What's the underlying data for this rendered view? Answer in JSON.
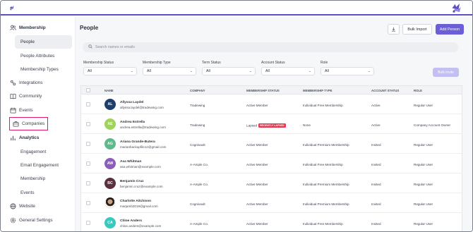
{
  "sidebar": {
    "membership_label": "Membership",
    "items": [
      {
        "label": "People"
      },
      {
        "label": "People Attributes"
      },
      {
        "label": "Membership Types"
      }
    ],
    "integrations_label": "Integrations",
    "community_label": "Community",
    "events_label": "Events",
    "companies_label": "Companies",
    "analytics_label": "Analytics",
    "analytics_items": [
      {
        "label": "Engagement"
      },
      {
        "label": "Email Engagement"
      },
      {
        "label": "Membership"
      },
      {
        "label": "Events"
      }
    ],
    "website_label": "Website",
    "settings_label": "General Settings"
  },
  "header": {
    "title": "People",
    "bulk_import_label": "Bulk Import",
    "add_person_label": "Add Person"
  },
  "search": {
    "placeholder": "Search names or emails"
  },
  "filters": [
    {
      "label": "Membership Status",
      "value": "All"
    },
    {
      "label": "Membership Type",
      "value": "All"
    },
    {
      "label": "Term Status",
      "value": "All"
    },
    {
      "label": "Account Status",
      "value": "All"
    },
    {
      "label": "Role",
      "value": "All"
    }
  ],
  "bulk_invite_label": "Bulk invite",
  "table": {
    "columns": [
      "NAME",
      "COMPANY",
      "MEMBERSHIP STATUS",
      "MEMBERSHIP TYPE",
      "ACCOUNT STATUS",
      "ROLE"
    ],
    "rows": [
      {
        "initials": "AL",
        "avatar_color": "#1f3f6b",
        "name": "Allyssa Laydel",
        "email": "allyssa.laydel@tradewing.com",
        "company": "Tradewing",
        "membership_status": "Active Member",
        "badge": "",
        "membership_type": "Individual Free Membership",
        "account_status": "Active",
        "role": "Regular User"
      },
      {
        "initials": "AE",
        "avatar_color": "#9fd35a",
        "name": "Andrea Estrella",
        "email": "andrea.estrella@tradewing.com",
        "company": "Tradewing",
        "membership_status": "Lapsed",
        "badge": "RECENTLY LAPSED",
        "membership_type": "None",
        "account_status": "Active",
        "role": "Company Account Owner"
      },
      {
        "initials": "AG",
        "avatar_color": "#5fb98c",
        "name": "Ariana Grande-Butera",
        "email": "marianbackupfile12@gmail.com",
        "company": "Cognivault",
        "membership_status": "Active Member",
        "badge": "",
        "membership_type": "Individual Premium Membership",
        "account_status": "Invited",
        "role": "Regular User"
      },
      {
        "initials": "AW",
        "avatar_color": "#8b5fb8",
        "name": "Asa Whitman",
        "email": "asa.whitman@example.com",
        "company": "A-Ample Co.",
        "membership_status": "Active Member",
        "badge": "",
        "membership_type": "Individual Free Membership",
        "account_status": "Invited",
        "role": "Regular User"
      },
      {
        "initials": "BC",
        "avatar_color": "#5a2f3f",
        "name": "Benjamin Cruz",
        "email": "benjamin.cruz@example.com",
        "company": "A-Ample Co.",
        "membership_status": "Active Member",
        "badge": "",
        "membership_type": "Individual Premium Membership",
        "account_status": "Invited",
        "role": "Regular User"
      },
      {
        "initials": "",
        "avatar_color": "photo",
        "name": "Charlotte Aitchison",
        "email": "marjamb2019@gmail.com",
        "company": "Cognivault",
        "membership_status": "Active Member",
        "badge": "",
        "membership_type": "Individual Premium Membership",
        "account_status": "Invited",
        "role": "Regular User"
      },
      {
        "initials": "CA",
        "avatar_color": "#35c9c0",
        "name": "Chloe Anders",
        "email": "chloe.anders@example.com",
        "company": "A-Ample Co.",
        "membership_status": "Active Member",
        "badge": "",
        "membership_type": "Individual Free Membership",
        "account_status": "Invited",
        "role": "Regular User"
      }
    ]
  }
}
